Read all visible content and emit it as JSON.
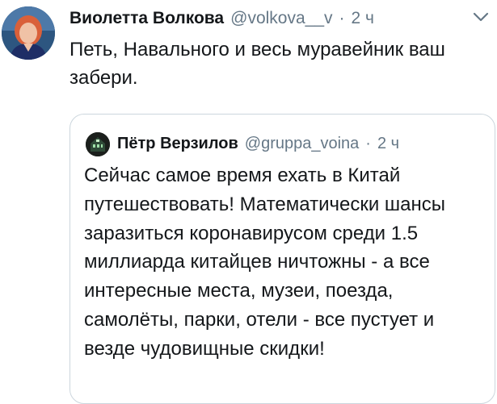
{
  "tweet": {
    "author_name": "Виолетта Волкова",
    "author_handle": "@volkova__v",
    "separator": "·",
    "time": "2 ч",
    "text": "Петь, Навального и весь муравейник ваш забери.",
    "avatar_icon": "user-avatar",
    "menu_icon": "chevron-down-icon"
  },
  "quoted_tweet": {
    "author_name": "Пётр Верзилов",
    "author_handle": "@gruppa_voina",
    "separator": "·",
    "time": "2 ч",
    "text": "Сейчас самое время ехать в Китай путешествовать! Математически шансы заразиться коронавирусом среди 1.5 миллиарда китайцев ничтожны - а все интересные места, музеи, поезда, самолёты, парки, отели - все пустует и везде чудовищные скидки!",
    "avatar_icon": "user-avatar"
  },
  "colors": {
    "text_primary": "#14171a",
    "text_secondary": "#657786",
    "border": "#ccd6dd",
    "background": "#ffffff"
  }
}
